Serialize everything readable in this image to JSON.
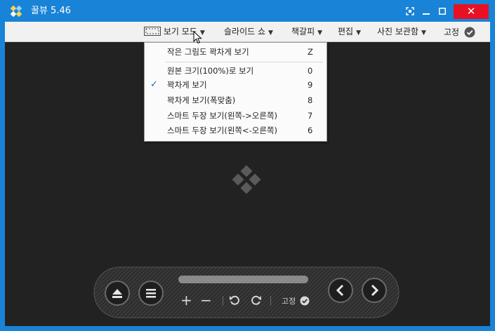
{
  "window": {
    "title": "꿀뷰 5.46",
    "controls": {
      "close": "✕"
    }
  },
  "menubar": {
    "items": [
      {
        "label": "보기 모드"
      },
      {
        "label": "슬라이드 쇼"
      },
      {
        "label": "책갈피"
      },
      {
        "label": "편집"
      },
      {
        "label": "사진 보관함"
      },
      {
        "label": "고정"
      }
    ]
  },
  "view_menu": {
    "items": [
      {
        "label": "작은 그림도 꽉차게 보기",
        "shortcut": "Z",
        "checked": false
      },
      {
        "label": "원본 크기(100%)로 보기",
        "shortcut": "0",
        "checked": false
      },
      {
        "label": "꽉차게 보기",
        "shortcut": "9",
        "checked": true
      },
      {
        "label": "꽉차게 보기(폭맞춤)",
        "shortcut": "8",
        "checked": false
      },
      {
        "label": "스마트 두장 보기(왼쪽->오른쪽)",
        "shortcut": "7",
        "checked": false
      },
      {
        "label": "스마트 두장 보기(왼쪽<-오른쪽)",
        "shortcut": "6",
        "checked": false
      }
    ],
    "check_mark": "✓"
  },
  "controller": {
    "pin_label": "고정",
    "zoom_in": "+",
    "zoom_out": "−"
  },
  "colors": {
    "title_bar": "#1883d7",
    "close_button": "#e81123",
    "viewer_bg": "#222222",
    "menu_bg": "#f1f1f1",
    "check": "#1a64c0"
  }
}
